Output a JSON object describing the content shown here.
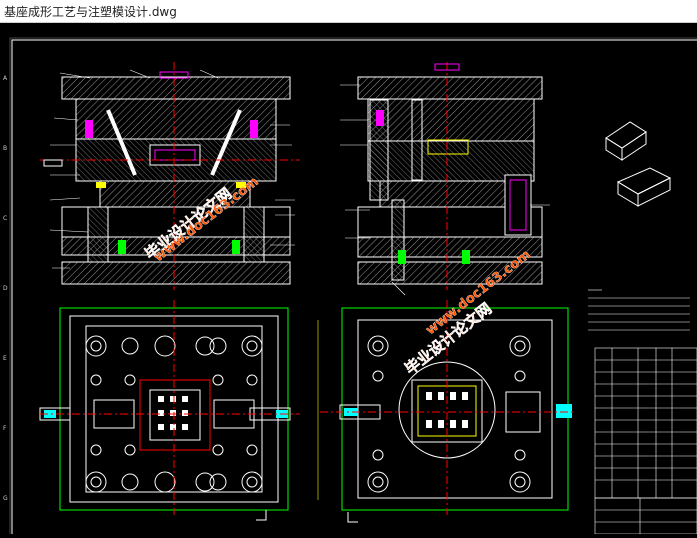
{
  "window": {
    "title": "基座成形工艺与注塑模设计.dwg"
  },
  "watermark": {
    "site": "www.doc163.com",
    "brand": "毕业设计论文网"
  },
  "side_labels": [
    "A",
    "B",
    "C",
    "D",
    "E",
    "F",
    "G"
  ],
  "colors": {
    "background": "#000000",
    "outline": "#ffffff",
    "green": "#00ff00",
    "red": "#ff0000",
    "magenta": "#ff00ff",
    "yellow": "#ffff00",
    "cyan": "#00ffff",
    "watermark": "#ff5500"
  }
}
